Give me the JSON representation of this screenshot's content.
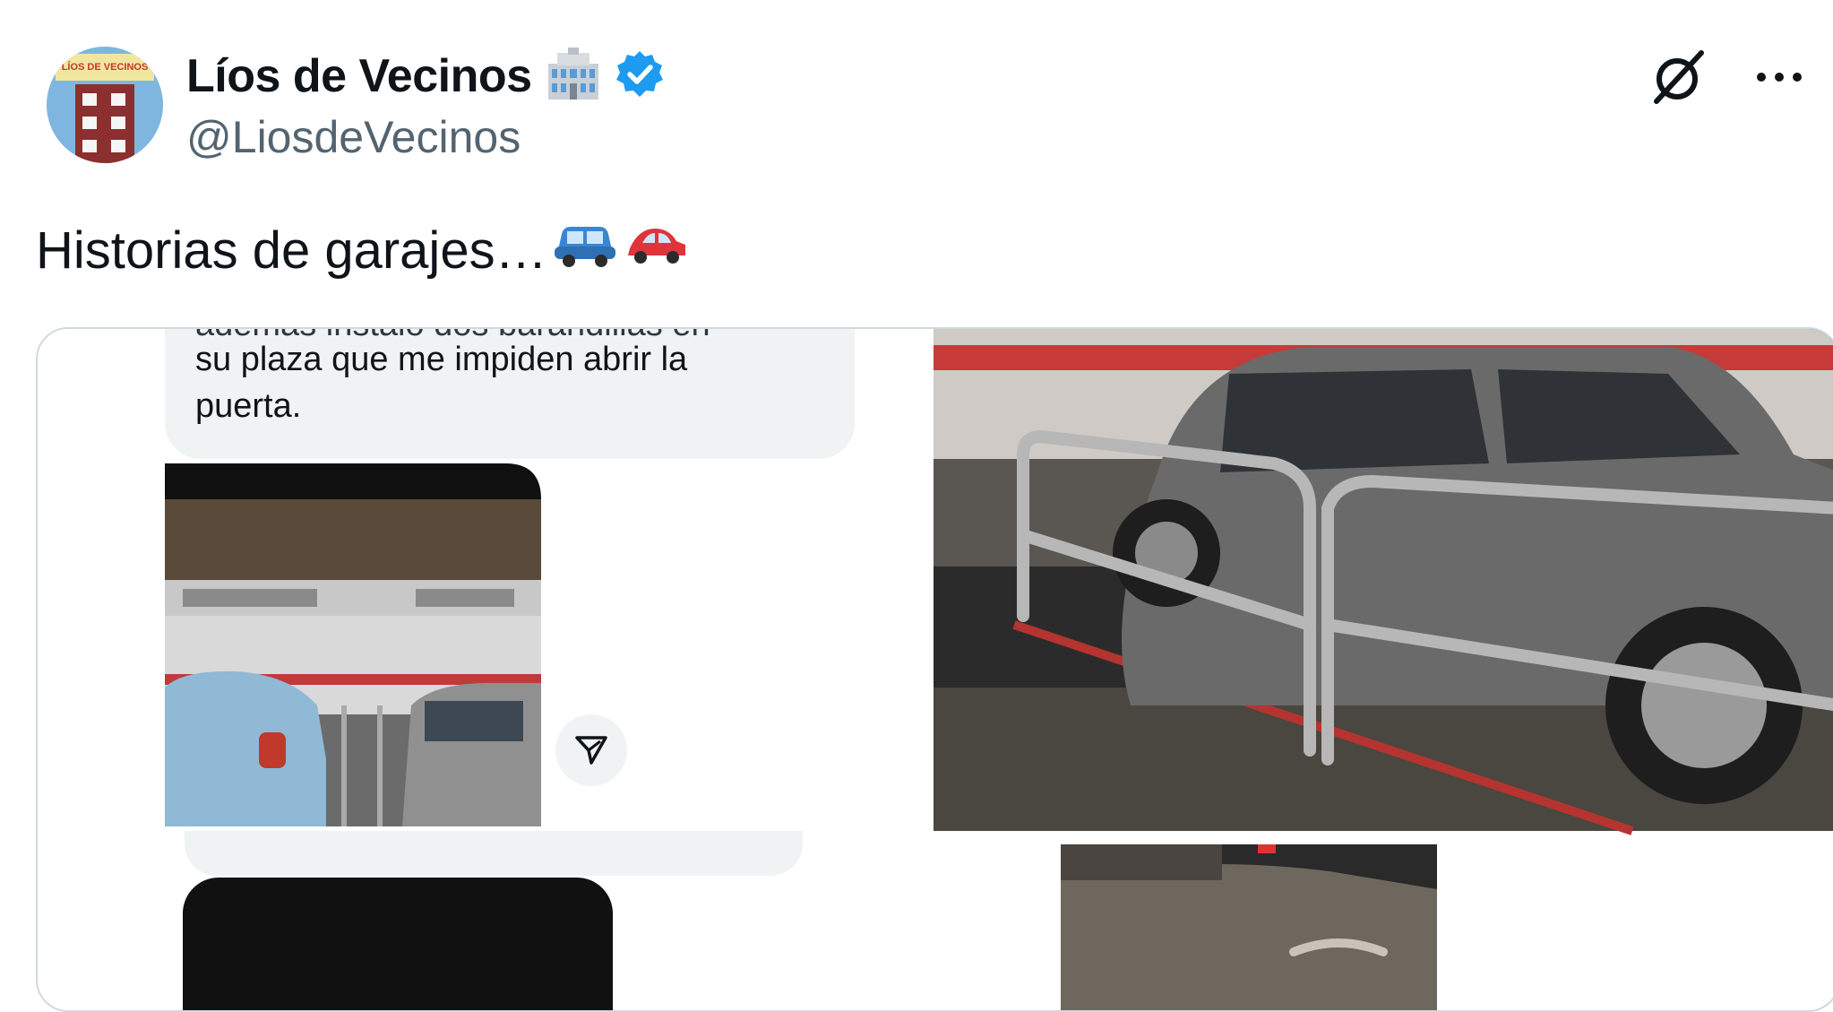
{
  "tweet": {
    "author": {
      "display_name": "Líos de Vecinos",
      "handle": "@LiosdeVecinos",
      "verified": true,
      "avatar_text": "LÍOS DE VECINOS",
      "name_emoji": "office-building-icon"
    },
    "text": "Historias de garajes…",
    "text_emojis": [
      "blue-car-icon",
      "red-car-icon"
    ],
    "actions": [
      "grok-icon",
      "more-icon"
    ]
  },
  "media": {
    "screenshot": {
      "message_cut_line": "además instaló dos barandillas en",
      "message_lines": [
        "su plaza que me impiden abrir la",
        "puerta."
      ],
      "share_icon": "send-icon"
    }
  },
  "colors": {
    "text": "#0f1419",
    "secondary": "#536471",
    "verified": "#1d9bf0",
    "border": "#cfd9de",
    "bubble": "#eff3f4"
  }
}
